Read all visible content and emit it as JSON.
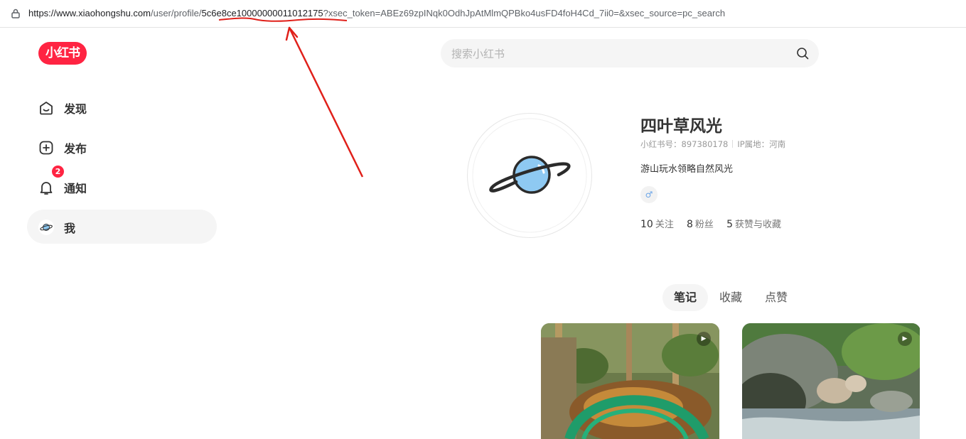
{
  "address_bar": {
    "url_host": "https://www.xiaohongshu.com",
    "url_path": "/user/profile/",
    "url_id": "5c6e8ce10000000011012175",
    "url_query": "?xsec_token=ABEz69zpINqk0OdhJpAtMlmQPBko4usFD4foH4Cd_7ii0=&xsec_source=pc_search"
  },
  "logo": {
    "text": "小红书"
  },
  "search": {
    "placeholder": "搜索小红书"
  },
  "sidebar": {
    "items": [
      {
        "label": "发现",
        "icon": "discover-icon"
      },
      {
        "label": "发布",
        "icon": "plus-square-icon"
      },
      {
        "label": "通知",
        "icon": "bell-icon",
        "badge": "2"
      },
      {
        "label": "我",
        "icon": "avatar-planet-icon"
      }
    ]
  },
  "profile": {
    "name": "四叶草风光",
    "id_label": "小红书号：897380178",
    "ip_label": "IP属地：河南",
    "bio": "游山玩水领略自然风光",
    "gender_symbol": "♂",
    "stats": [
      {
        "num": "10",
        "label": "关注"
      },
      {
        "num": "8",
        "label": "粉丝"
      },
      {
        "num": "5",
        "label": "获赞与收藏"
      }
    ]
  },
  "tabs": [
    "笔记",
    "收藏",
    "点赞"
  ],
  "notes": [
    {
      "play": "▶"
    },
    {
      "play": "▶"
    }
  ],
  "colors": {
    "brand": "#ff2442",
    "annotation": "#e0201a"
  }
}
